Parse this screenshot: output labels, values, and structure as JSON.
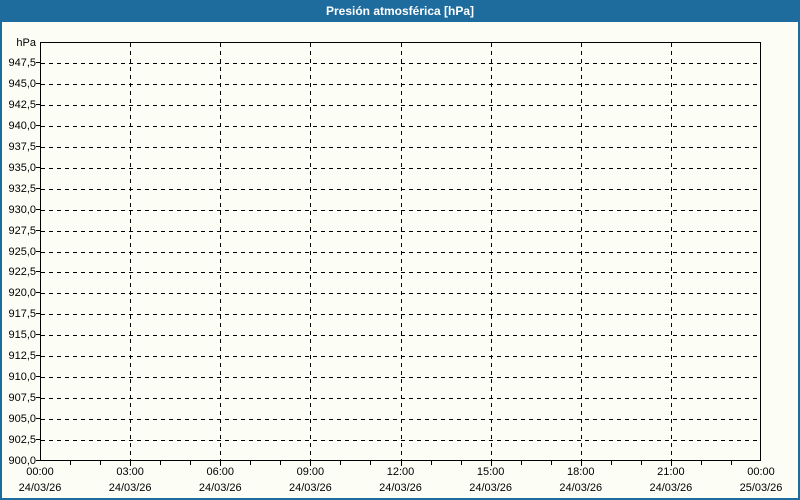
{
  "header": {
    "title": "Presión atmosférica [hPa]"
  },
  "colors": {
    "accent_blue": "#1e6b9e",
    "background": "#fcfef6",
    "grid_black": "#000000",
    "title_text": "#ffffff"
  },
  "chart_data": {
    "type": "line",
    "title": "Presión atmosférica [hPa]",
    "unit_label": "hPa",
    "ylabel": "hPa",
    "ylim": [
      900,
      950
    ],
    "y_tick_step": 2.5,
    "y_tick_labels": [
      "947,5",
      "945,0",
      "942,5",
      "940,0",
      "937,5",
      "935,0",
      "932,5",
      "930,0",
      "927,5",
      "925,0",
      "922,5",
      "920,0",
      "917,5",
      "915,0",
      "912,5",
      "910,0",
      "907,5",
      "905,0",
      "902,5",
      "900,0"
    ],
    "x_range_hours": [
      0,
      24
    ],
    "x_major_step_hours": 3,
    "x_minor_step_hours": 1,
    "x_tick_labels": [
      {
        "time": "00:00",
        "date": "24/03/26"
      },
      {
        "time": "03:00",
        "date": "24/03/26"
      },
      {
        "time": "06:00",
        "date": "24/03/26"
      },
      {
        "time": "09:00",
        "date": "24/03/26"
      },
      {
        "time": "12:00",
        "date": "24/03/26"
      },
      {
        "time": "15:00",
        "date": "24/03/26"
      },
      {
        "time": "18:00",
        "date": "24/03/26"
      },
      {
        "time": "21:00",
        "date": "24/03/26"
      },
      {
        "time": "00:00",
        "date": "25/03/26"
      }
    ],
    "grid": "dashed",
    "legend": null,
    "series": []
  }
}
